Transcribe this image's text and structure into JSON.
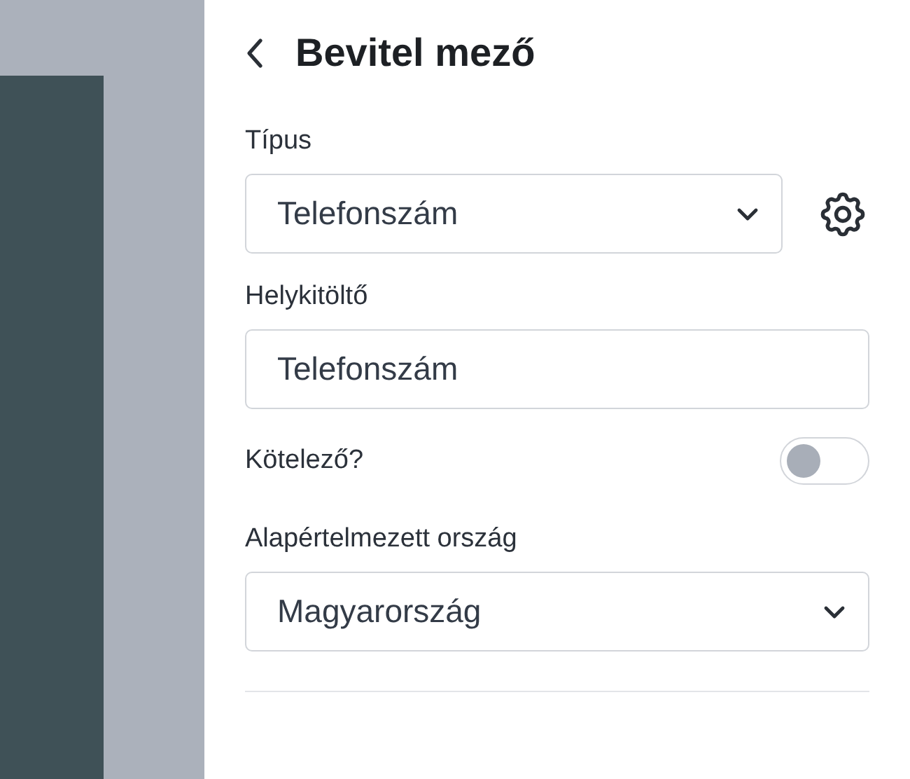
{
  "header": {
    "title": "Bevitel mező"
  },
  "fields": [
    {
      "kind": "select",
      "label": "Típus",
      "value": "Telefonszám",
      "settings": true
    },
    {
      "kind": "text",
      "label": "Helykitöltő",
      "value": "Telefonszám"
    },
    {
      "kind": "toggle",
      "label": "Kötelező?",
      "on": false
    },
    {
      "kind": "select",
      "label": "Alapértelmezett ország",
      "value": "Magyarország",
      "settings": false
    }
  ]
}
